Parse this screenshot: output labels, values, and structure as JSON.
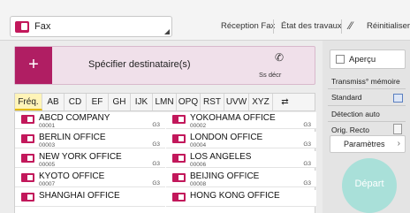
{
  "header": {
    "app_title": "Fax",
    "buttons": [
      "Réception Fax",
      "État des travaux",
      "Réinitialiser"
    ]
  },
  "destination": {
    "label": "Spécifier destinataire(s)",
    "plus": "+",
    "hook_label": "Ss décr"
  },
  "tabs": [
    "Fréq.",
    "AB",
    "CD",
    "EF",
    "GH",
    "IJK",
    "LMN",
    "OPQ",
    "RST",
    "UVW",
    "XYZ",
    "⇄"
  ],
  "entries": [
    {
      "name": "ABCD COMPANY",
      "number": "00001",
      "type": "G3"
    },
    {
      "name": "YOKOHAMA OFFICE",
      "number": "00002",
      "type": "G3"
    },
    {
      "name": "BERLIN OFFICE",
      "number": "00003",
      "type": "G3"
    },
    {
      "name": "LONDON OFFICE",
      "number": "00004",
      "type": "G3"
    },
    {
      "name": "NEW YORK OFFICE",
      "number": "00005",
      "type": "G3"
    },
    {
      "name": "LOS ANGELES",
      "number": "00006",
      "type": "G3"
    },
    {
      "name": "KYOTO OFFICE",
      "number": "00007",
      "type": "G3"
    },
    {
      "name": "BEIJING OFFICE",
      "number": "00008",
      "type": "G3"
    },
    {
      "name": "SHANGHAI  OFFICE",
      "number": "",
      "type": ""
    },
    {
      "name": "HONG KONG OFFICE",
      "number": "",
      "type": ""
    }
  ],
  "panel": {
    "preview": "Aperçu",
    "transmit": "Transmiss° mémoire",
    "standard": "Standard",
    "detect": "Détection auto",
    "recto": "Orig. Recto",
    "settings": "Paramètres",
    "start": "Départ"
  },
  "colors": {
    "accent": "#b01e63",
    "start": "#a9e0d9",
    "tab_active": "#fff4b8"
  }
}
